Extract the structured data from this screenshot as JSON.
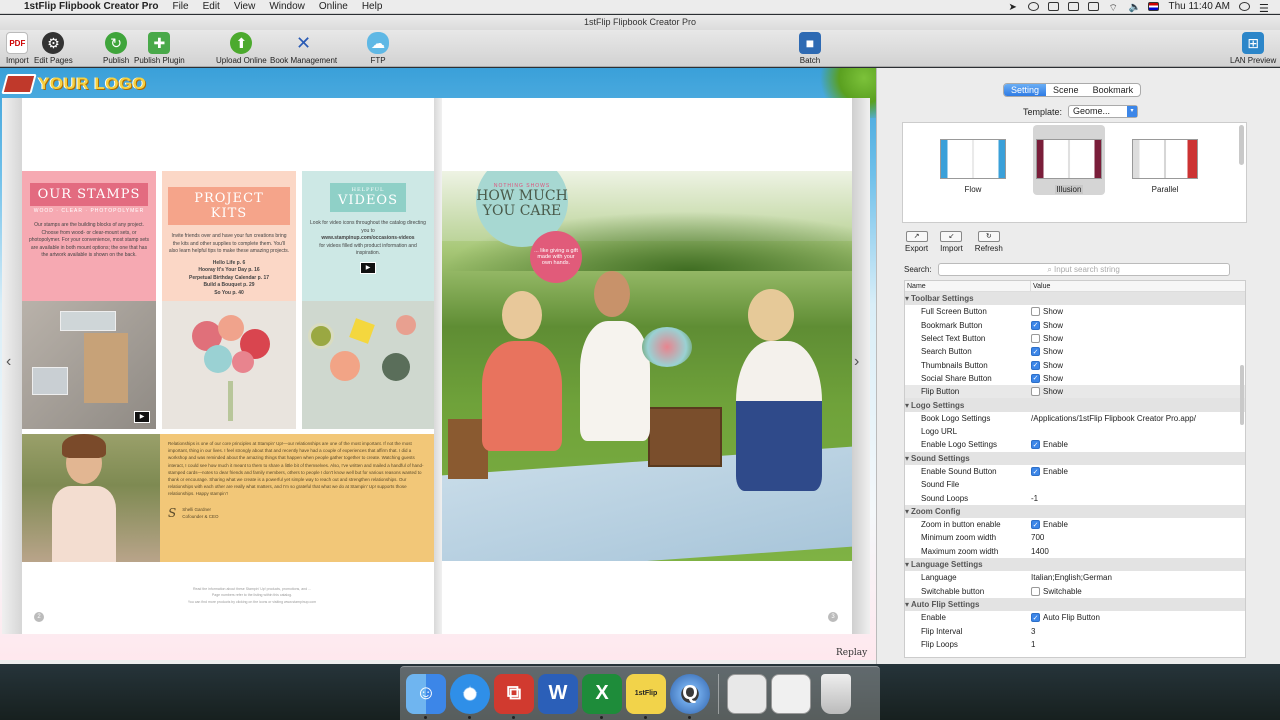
{
  "menubar": {
    "app_name": "1stFlip Flipbook Creator Pro",
    "menus": [
      "File",
      "Edit",
      "View",
      "Window",
      "Online",
      "Help"
    ],
    "clock": "Thu 11:40 AM"
  },
  "window": {
    "title": "1stFlip Flipbook Creator Pro"
  },
  "toolbar": {
    "import": "Import",
    "edit_pages": "Edit Pages",
    "publish": "Publish",
    "publish_plugin": "Publish Plugin",
    "upload_online": "Upload Online",
    "book_management": "Book Management",
    "ftp": "FTP",
    "batch": "Batch",
    "lan_preview": "LAN Preview"
  },
  "book": {
    "logo_text": "YOUR LOGO",
    "panel1": {
      "title": "OUR STAMPS",
      "subtitle": "WOOD · CLEAR · PHOTOPOLYMER",
      "body": "Our stamps are the building blocks of any project. Choose from wood- or clear-mount sets, or photopolymer. For your convenience, most stamp sets are available in both mount options; the one that has the artwork available is shown on the back."
    },
    "panel2": {
      "title": "PROJECT KITS",
      "body": "Invite friends over and have your fun creations bring the kits and other supplies to complete them. You'll also learn helpful tips to make these amazing projects.",
      "items": [
        "Hello Life p. 6",
        "Hooray It's Your Day p. 16",
        "Perpetual Birthday Calendar p. 17",
        "Build a Bouquet p. 29",
        "So You p. 40"
      ]
    },
    "panel3": {
      "title": "VIDEOS",
      "pre": "HELPFUL",
      "body": "Look for video icons throughout the catalog directing you to",
      "link": "www.stampinup.com/occasions-videos",
      "body2": "for videos filled with product information and inspiration."
    },
    "quote": "Relationships is one of our core principles at Stampin' Up!—our relationships are one of the most important. If not the most important, thing in our lives. I feel strongly about that and recently have had a couple of experiences that affirm that. I did a workshop and was reminded about the amazing things that happen when people gather together to create. Watching guests interact, I could see how much it meant to them to share a little bit of themselves. Also, I've written and mailed a handful of hand-stamped cards—notes to dear friends and family members, others to people I don't know well but for various reasons wanted to thank or encourage. Sharing what we create is a powerful yet simple way to reach out and strengthen relationships. Our relationships with each other are really what matters, and I'm so grateful that what we do at Stampin' Up! supports those relationships. Happy stampin'!",
    "signer_name": "Shelli Gardner",
    "signer_title": "Cofounder & CEO",
    "footer_line1": "Read the information about these Stampin' Up! products, promotions, and ...",
    "footer_line2": "Page numbers refer to the listing within this catalog.",
    "footer_line3": "You can find more products by clicking on the icons or visiting www.stampinup.com",
    "page_left": "2",
    "page_right": "3",
    "headline_pre": "NOTHING SHOWS",
    "headline": "HOW MUCH YOU CARE",
    "pink_bubble": "... like giving a gift made with your own hands.",
    "replay": "Replay"
  },
  "settings": {
    "tabs": [
      "Setting",
      "Scene",
      "Bookmark"
    ],
    "active_tab": "Setting",
    "template_label": "Template:",
    "template_value": "Geome...",
    "templates": [
      {
        "name": "Flow"
      },
      {
        "name": "Illusion",
        "selected": true
      },
      {
        "name": "Parallel"
      }
    ],
    "actions": [
      "Export",
      "Import",
      "Refresh"
    ],
    "search_label": "Search:",
    "search_placeholder": "Input search string",
    "grid_head": {
      "name": "Name",
      "value": "Value"
    },
    "groups": [
      {
        "title": "Toolbar Settings",
        "rows": [
          {
            "k": "Full Screen Button",
            "check": false,
            "v": "Show"
          },
          {
            "k": "Bookmark Button",
            "check": true,
            "v": "Show"
          },
          {
            "k": "Select Text Button",
            "check": false,
            "v": "Show"
          },
          {
            "k": "Search Button",
            "check": true,
            "v": "Show"
          },
          {
            "k": "Thumbnails Button",
            "check": true,
            "v": "Show"
          },
          {
            "k": "Social Share Button",
            "check": true,
            "v": "Show"
          },
          {
            "k": "Flip Button",
            "check": false,
            "v": "Show",
            "hl": true
          }
        ]
      },
      {
        "title": "Logo Settings",
        "rows": [
          {
            "k": "Book Logo Settings",
            "v": "/Applications/1stFlip Flipbook Creator Pro.app/"
          },
          {
            "k": "Logo URL",
            "v": ""
          },
          {
            "k": "Enable Logo Settings",
            "check": true,
            "v": "Enable"
          }
        ]
      },
      {
        "title": "Sound Settings",
        "rows": [
          {
            "k": "Enable Sound Button",
            "check": true,
            "v": "Enable"
          },
          {
            "k": "Sound File",
            "v": ""
          },
          {
            "k": "Sound Loops",
            "v": "-1"
          }
        ]
      },
      {
        "title": "Zoom Config",
        "rows": [
          {
            "k": "Zoom in button enable",
            "check": true,
            "v": "Enable"
          },
          {
            "k": "Minimum zoom width",
            "v": "700"
          },
          {
            "k": "Maximum zoom width",
            "v": "1400"
          }
        ]
      },
      {
        "title": "Language Settings",
        "rows": [
          {
            "k": "Language",
            "v": "Italian;English;German"
          },
          {
            "k": "Switchable button",
            "check": false,
            "v": "Switchable"
          }
        ]
      },
      {
        "title": "Auto Flip Settings",
        "rows": [
          {
            "k": "Enable",
            "check": true,
            "v": "Auto Flip Button"
          },
          {
            "k": "Flip Interval",
            "v": "3"
          },
          {
            "k": "Flip Loops",
            "v": "1"
          }
        ]
      }
    ]
  },
  "dock": {
    "items": [
      "finder-icon",
      "safari-icon",
      "screen-share-icon",
      "word-icon",
      "excel-icon",
      "1stflip-icon",
      "quicktime-icon",
      "preview-window-icon",
      "window-icon",
      "trash-icon"
    ]
  }
}
